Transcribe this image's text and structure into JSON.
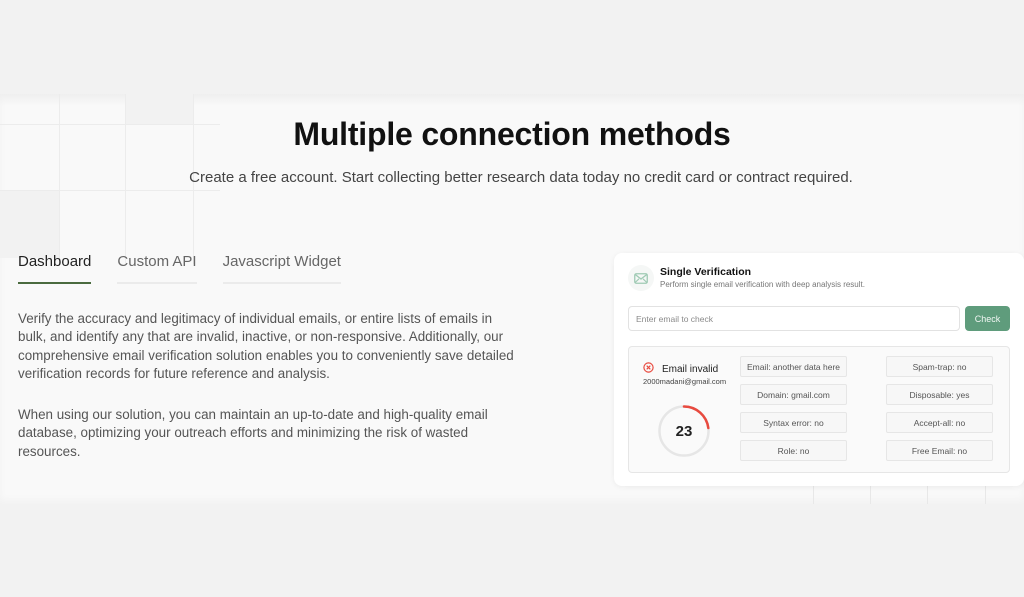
{
  "header": {
    "title": "Multiple connection methods",
    "subtitle": "Create a free account. Start collecting better research data today no credit card or contract required."
  },
  "tabs": [
    {
      "label": "Dashboard",
      "active": true
    },
    {
      "label": "Custom API",
      "active": false
    },
    {
      "label": "Javascript Widget",
      "active": false
    }
  ],
  "description": {
    "paragraph1": "Verify the accuracy and legitimacy of individual emails, or entire lists of emails in bulk, and identify any that are invalid, inactive, or non-responsive. Additionally, our comprehensive email verification solution enables you to conveniently save detailed verification records for future reference and analysis.",
    "paragraph2": "When using our solution, you can maintain an up-to-date and high-quality email database, optimizing your outreach efforts and minimizing the risk of wasted resources."
  },
  "card": {
    "icon": "mail-icon",
    "title": "Single Verification",
    "subtitle": "Perform single email verification with deep analysis result.",
    "input": {
      "value": "",
      "placeholder": "Enter email to check"
    },
    "check_label": "Check",
    "result": {
      "status_icon": "error-circle-icon",
      "status": "Email invalid",
      "email": "2000madani@gmail.com",
      "score": "23",
      "score_percent": 23,
      "attributes_left": [
        "Email: another data here",
        "Domain: gmail.com",
        "Syntax error: no",
        "Role: no"
      ],
      "attributes_right": [
        "Spam-trap: no",
        "Disposable: yes",
        "Accept-all: no",
        "Free Email: no"
      ]
    }
  },
  "colors": {
    "accent_green": "#5f9c7c",
    "tab_active_underline": "#4a6b3f",
    "error_red": "#e84a3f",
    "gauge_track": "#e6e6e6"
  }
}
